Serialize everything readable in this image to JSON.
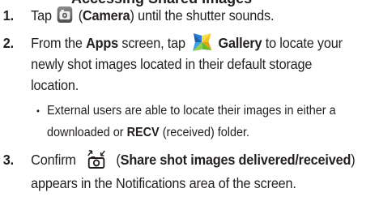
{
  "header_fragment": "Accessing Shared Images",
  "steps": [
    {
      "num": "1.",
      "pre": "Tap",
      "icon": "camera-icon",
      "paren_open": "(",
      "bold": "Camera",
      "paren_close": ")",
      "post": "until the shutter sounds."
    },
    {
      "num": "2.",
      "pre": "From the",
      "bold1": "Apps",
      "mid": "screen, tap",
      "icon": "gallery-icon",
      "bold2": "Gallery",
      "post": "to locate your",
      "line2": "newly shot images located in their default storage",
      "line3": "location."
    },
    {
      "num": "3.",
      "pre": "Confirm",
      "icon": "share-shot-icon",
      "paren_open": "(",
      "bold": "Share shot images delivered/received",
      "paren_close": ")",
      "line2": "appears in the Notifications area of the screen."
    }
  ],
  "sub_bullet": {
    "symbol": "•",
    "line1": "External users are able to locate their images in either a",
    "line2_pre": "downloaded or",
    "line2_bold": "RECV",
    "line2_post": "(received) folder."
  }
}
